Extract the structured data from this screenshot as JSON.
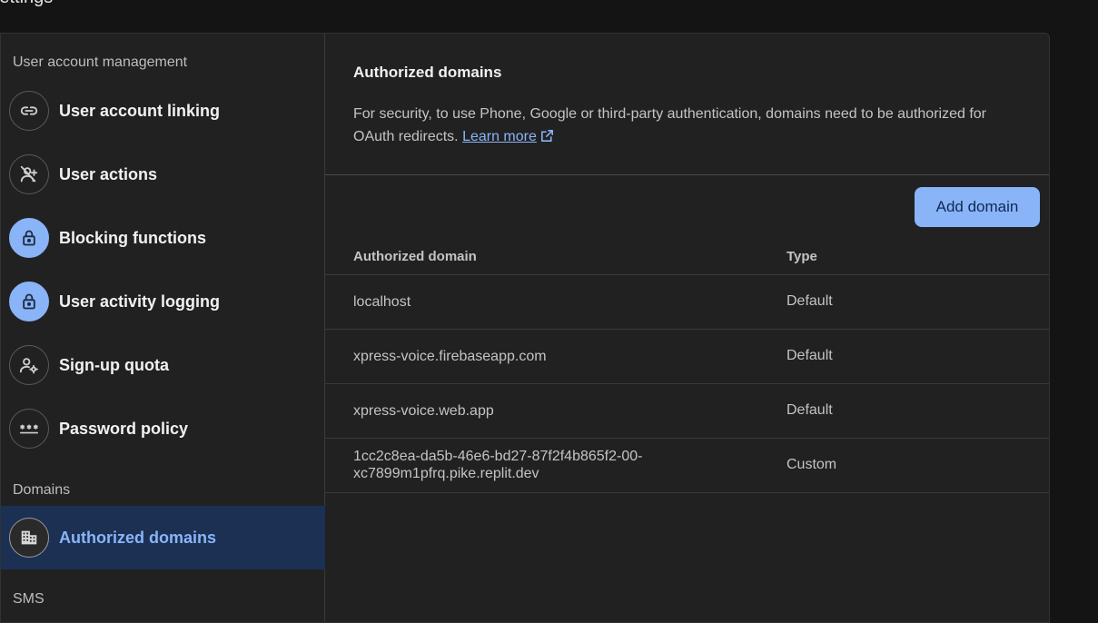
{
  "page": {
    "title": "Settings"
  },
  "sidebar": {
    "section_user": "User account management",
    "section_domains": "Domains",
    "section_sms": "SMS",
    "items": [
      {
        "label": "User account linking",
        "icon": "link-icon"
      },
      {
        "label": "User actions",
        "icon": "person-off-icon"
      },
      {
        "label": "Blocking functions",
        "icon": "lock-icon"
      },
      {
        "label": "User activity logging",
        "icon": "lock-icon"
      },
      {
        "label": "Sign-up quota",
        "icon": "person-settings-icon"
      },
      {
        "label": "Password policy",
        "icon": "password-icon"
      },
      {
        "label": "Authorized domains",
        "icon": "domain-icon",
        "active": true
      }
    ]
  },
  "main": {
    "title": "Authorized domains",
    "description": "For security, to use Phone, Google or third-party authentication, domains need to be authorized for OAuth redirects.",
    "learn_more": "Learn more",
    "add_button": "Add domain",
    "columns": {
      "domain": "Authorized domain",
      "type": "Type"
    },
    "rows": [
      {
        "domain_line1": "localhost",
        "domain_line2": "",
        "type": "Default"
      },
      {
        "domain_line1": "xpress-voice.firebaseapp.com",
        "domain_line2": "",
        "type": "Default"
      },
      {
        "domain_line1": "xpress-voice.web.app",
        "domain_line2": "",
        "type": "Default"
      },
      {
        "domain_line1": "1cc2c8ea-da5b-46e6-bd27-87f2f4b865f2-00-",
        "domain_line2": "xc7899m1pfrq.pike.replit.dev",
        "type": "Custom"
      }
    ]
  },
  "colors": {
    "accent": "#8ab4f8",
    "active_bg": "#1b3052",
    "card_bg": "#212121",
    "page_bg": "#141414"
  }
}
